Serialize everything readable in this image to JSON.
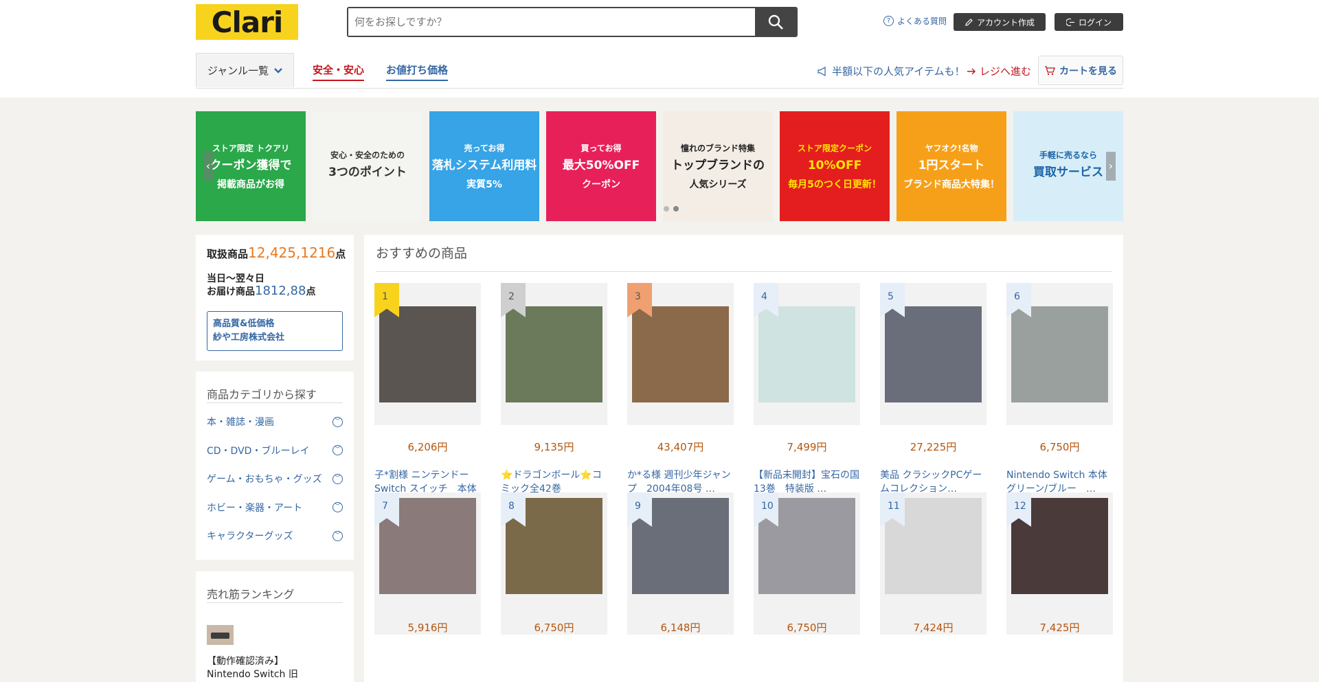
{
  "header": {
    "logo": "Clari",
    "search_placeholder": "何をお探しですか？",
    "faq": "よくある質問",
    "create_account": "アカウント作成",
    "login": "ログイン"
  },
  "nav": {
    "genre": "ジャンル一覧",
    "safe": "安全・安心",
    "bargain": "お値打ち価格",
    "promo": "半額以下の人気アイテムも！",
    "checkout": "レジへ進む",
    "cart": "カートを見る"
  },
  "banners": [
    {
      "top": "ストア限定 トクアリ",
      "main": "クーポン獲得で",
      "sub": "掲載商品がお得",
      "bg": "#2aa84a",
      "fg": "#ffffff"
    },
    {
      "top": "安心・安全のための",
      "main": "3つのポイント",
      "sub": "",
      "bg": "#f4f4f0",
      "fg": "#333333"
    },
    {
      "top": "売ってお得",
      "main": "落札システム利用料",
      "sub": "実質5%",
      "bg": "#36a4e6",
      "fg": "#ffffff"
    },
    {
      "top": "買ってお得",
      "main": "最大50%OFF",
      "sub": "クーポン",
      "bg": "#e8205a",
      "fg": "#ffffff"
    },
    {
      "top": "憧れのブランド特集",
      "main": "トップブランドの",
      "sub": "人気シリーズ",
      "bg": "#f4ede6",
      "fg": "#222222"
    },
    {
      "top": "ストア限定クーポン",
      "main": "10%OFF",
      "sub": "毎月5のつく日更新！",
      "bg": "#e41e1e",
      "fg": "#ffe600"
    },
    {
      "top": "ヤフオク!名物",
      "main": "1円スタート",
      "sub": "ブランド商品大特集！",
      "bg": "#f6a019",
      "fg": "#ffffff"
    },
    {
      "top": "手軽に売るなら",
      "main": "買取サービス",
      "sub": "",
      "bg": "#d7eef8",
      "fg": "#1b64a8"
    }
  ],
  "stats": {
    "items_label": "取扱商品",
    "items_count": "12,425,1216",
    "unit": "点",
    "delivery_line1": "当日〜翌々日",
    "delivery_label": "お届け商品",
    "delivery_count": "1812,88",
    "company_line1": "高品質&低価格",
    "company_line2": "紗や工房株式会社"
  },
  "categories": {
    "title": "商品カテゴリから探す",
    "items": [
      "本・雑誌・漫画",
      "CD・DVD・ブルーレイ",
      "ゲーム・おもちゃ・グッズ",
      "ホビー・楽器・アート",
      "キャラクターグッズ"
    ]
  },
  "ranking": {
    "title": "売れ筋ランキング",
    "item_line1": "【動作確認済み】",
    "item_line2": "Nintendo Switch 旧"
  },
  "recommend": {
    "title": "おすすめの商品",
    "products": [
      {
        "rank": "1",
        "price": "6,206円",
        "name": "子*割様 ニンテンドーSwitch スイッチ　本体",
        "thumb": "#5a5550"
      },
      {
        "rank": "2",
        "price": "9,135円",
        "name": "⭐ドラゴンボール⭐コミック全42巻",
        "thumb": "#6a7a5a"
      },
      {
        "rank": "3",
        "price": "43,407円",
        "name": "か*る様 週刊少年ジャンプ　2004年08号 …",
        "thumb": "#8a6a4a"
      },
      {
        "rank": "4",
        "price": "7,499円",
        "name": "【新品未開封】宝石の国　13巻　特装版 …",
        "thumb": "#cfe3e0"
      },
      {
        "rank": "5",
        "price": "27,225円",
        "name": "美品 クラシックPCゲームコレクション…",
        "thumb": "#6a6e7a"
      },
      {
        "rank": "6",
        "price": "6,750円",
        "name": "Nintendo Switch 本体 グリーン/ブルー　…",
        "thumb": "#9aa09e"
      },
      {
        "rank": "7",
        "price": "5,916円",
        "name": "",
        "thumb": "#8a7a7a"
      },
      {
        "rank": "8",
        "price": "6,750円",
        "name": "",
        "thumb": "#7a6a4a"
      },
      {
        "rank": "9",
        "price": "6,148円",
        "name": "",
        "thumb": "#6a6e78"
      },
      {
        "rank": "10",
        "price": "6,750円",
        "name": "",
        "thumb": "#9a9aa0"
      },
      {
        "rank": "11",
        "price": "7,424円",
        "name": "",
        "thumb": "#d8d8d8"
      },
      {
        "rank": "12",
        "price": "7,425円",
        "name": "",
        "thumb": "#4a3a3a"
      }
    ]
  },
  "colors": {
    "accent_blue": "#3466a3",
    "price_orange": "#b3560e",
    "stat_orange": "#e8781e",
    "safe_red": "#c4161c",
    "logo_yellow": "#f8d31d"
  }
}
